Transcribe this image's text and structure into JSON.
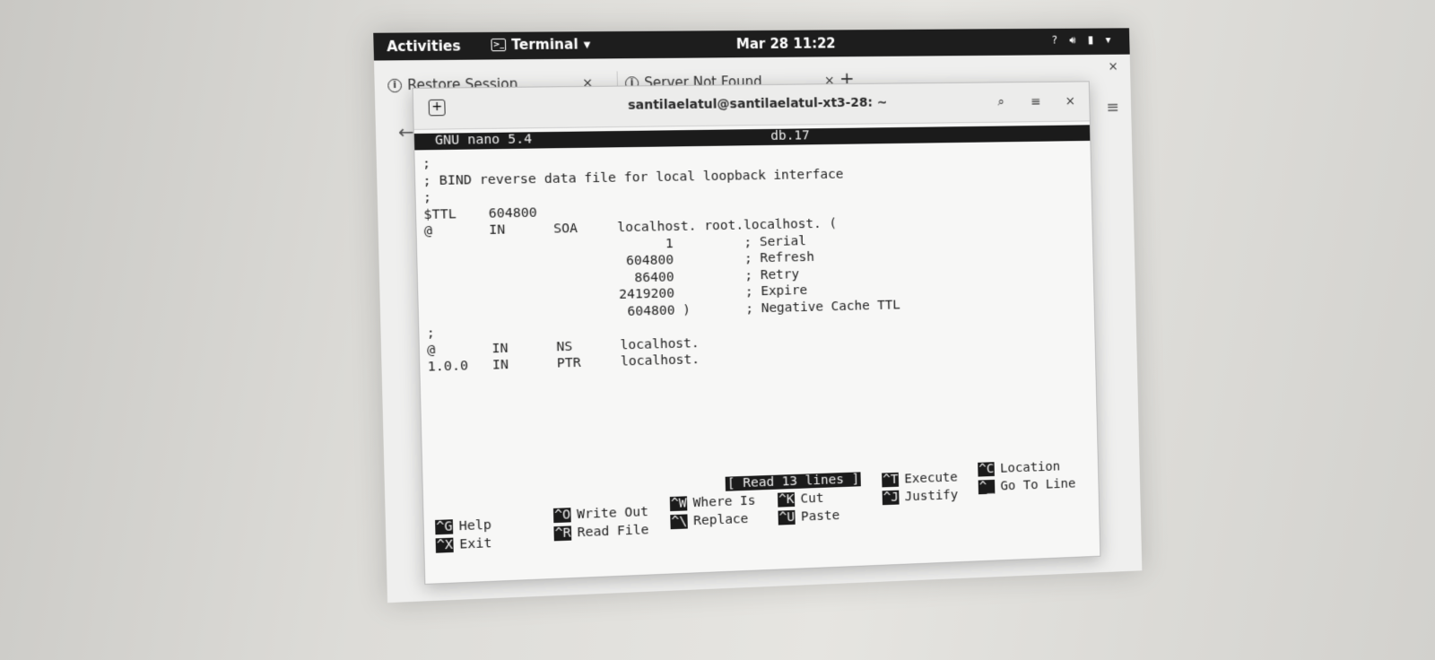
{
  "topbar": {
    "activities": "Activities",
    "app_name": "Terminal",
    "clock": "Mar 28  11:22",
    "status_icons": [
      "help-icon",
      "volume-icon",
      "battery-icon",
      "menu-down-icon"
    ]
  },
  "browser": {
    "tabs": [
      {
        "label": "Restore Session"
      },
      {
        "label": "Server Not Found"
      }
    ],
    "new_tab": "+",
    "close": "×"
  },
  "terminal": {
    "title": "santilaelatul@santilaelatul-xt3-28: ~",
    "search_icon": "⌕",
    "menu_icon": "≡",
    "close_icon": "×"
  },
  "nano": {
    "version": "GNU nano 5.4",
    "filename": "db.17",
    "content": ";\n; BIND reverse data file for local loopback interface\n;\n$TTL    604800\n@       IN      SOA     localhost. root.localhost. (\n                              1         ; Serial\n                         604800         ; Refresh\n                          86400         ; Retry\n                        2419200         ; Expire\n                         604800 )       ; Negative Cache TTL\n;\n@       IN      NS      localhost.\n1.0.0   IN      PTR     localhost.",
    "status_message": "[ Read 13 lines ]",
    "shortcuts": [
      {
        "key": "^G",
        "label": "Help"
      },
      {
        "key": "^X",
        "label": "Exit"
      },
      {
        "key": "^O",
        "label": "Write Out"
      },
      {
        "key": "^R",
        "label": "Read File"
      },
      {
        "key": "^W",
        "label": "Where Is"
      },
      {
        "key": "^\\",
        "label": "Replace"
      },
      {
        "key": "^K",
        "label": "Cut"
      },
      {
        "key": "^U",
        "label": "Paste"
      },
      {
        "key": "^T",
        "label": "Execute"
      },
      {
        "key": "^J",
        "label": "Justify"
      },
      {
        "key": "^C",
        "label": "Location"
      },
      {
        "key": "^_",
        "label": "Go To Line"
      }
    ]
  }
}
